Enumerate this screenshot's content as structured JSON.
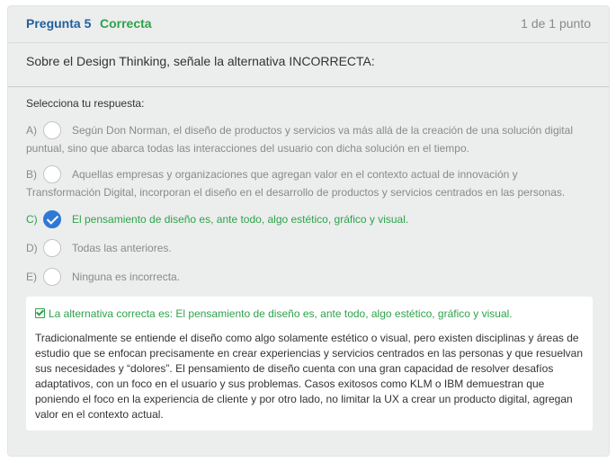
{
  "question": {
    "number_label": "Pregunta 5",
    "status": "Correcta",
    "score": "1 de 1 punto",
    "statement": "Sobre el Design Thinking, señale la alternativa INCORRECTA:"
  },
  "answer_prompt": "Selecciona tu respuesta:",
  "options": [
    {
      "letter": "A)",
      "text": "Según Don Norman, el diseño de productos y servicios va más allá de la creación de una solución digital puntual, sino que abarca todas las interacciones del usuario con dicha solución en el tiempo.",
      "selected": false
    },
    {
      "letter": "B)",
      "text": "Aquellas empresas y organizaciones que agregan valor en el contexto actual de innovación y Transformación Digital, incorporan el diseño en el desarrollo de productos y servicios centrados en las personas.",
      "selected": false
    },
    {
      "letter": "C)",
      "text": "El pensamiento de diseño es, ante todo, algo estético, gráfico y visual.",
      "selected": true
    },
    {
      "letter": "D)",
      "text": "Todas las anteriores.",
      "selected": false
    },
    {
      "letter": "E)",
      "text": "Ninguna es incorrecta.",
      "selected": false
    }
  ],
  "feedback": {
    "title": "La alternativa correcta es: El pensamiento de diseño es, ante todo, algo estético, gráfico y visual.",
    "body": "Tradicionalmente se entiende el diseño como algo solamente estético o visual, pero existen disciplinas y áreas de estudio que se enfocan precisamente en crear experiencias y servicios centrados en las personas y que resuelvan sus necesidades y “dolores”. El pensamiento de diseño cuenta con una gran capacidad de resolver desafíos adaptativos, con un foco en el usuario y sus problemas. Casos exitosos como KLM o IBM demuestran que poniendo el foco en la experiencia de cliente y por otro lado, no limitar la UX a crear un producto digital, agregan valor en el contexto actual."
  },
  "colors": {
    "question_number": "#1f5f9e",
    "correct_green": "#2ea34a",
    "radio_selected": "#2f79d6",
    "card_bg": "#eceded"
  },
  "icons": {
    "selected_radio": "check-circle-icon",
    "feedback_check": "check-square-icon"
  }
}
